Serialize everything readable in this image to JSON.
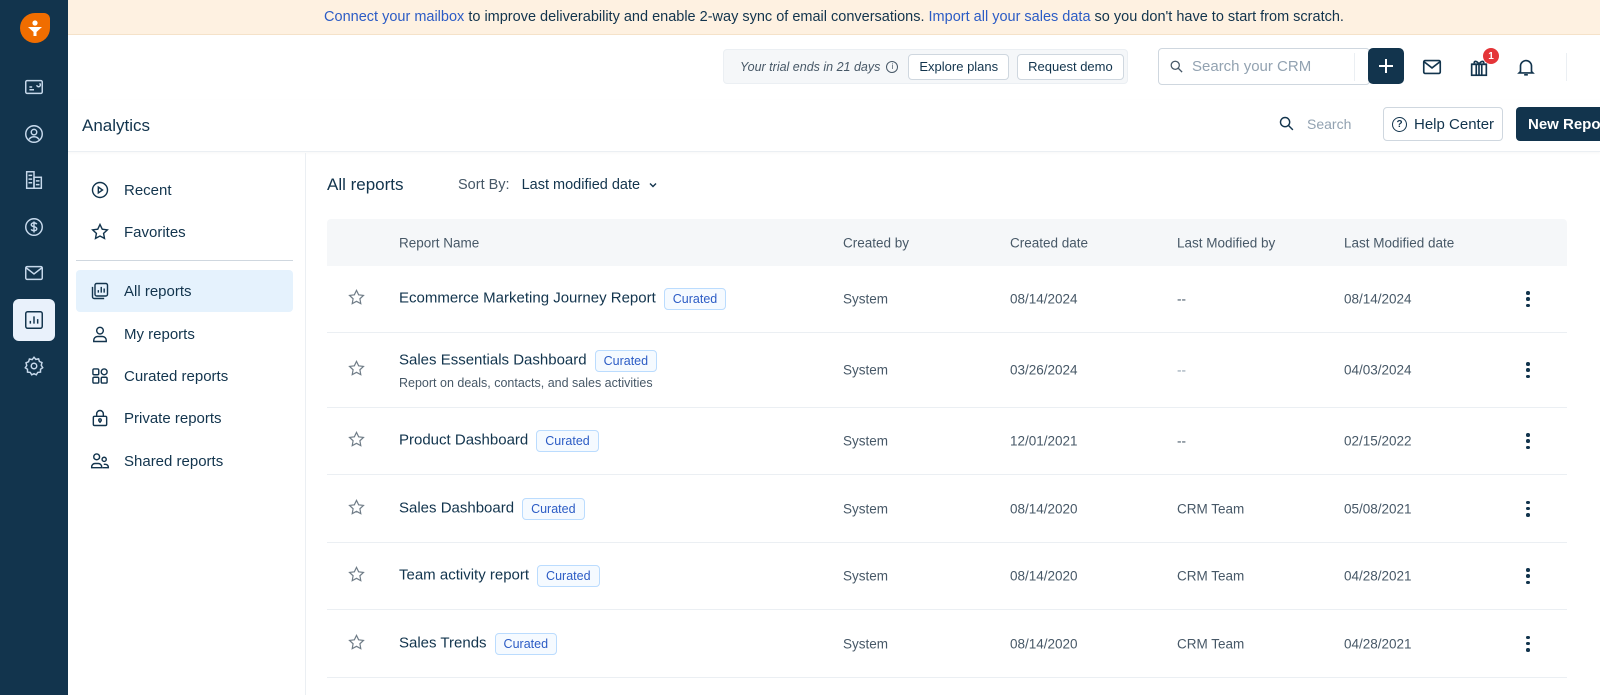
{
  "banner": {
    "link1": "Connect your mailbox",
    "text1": " to improve deliverability and enable 2-way sync of email conversations. ",
    "link2": "Import all your sales data",
    "text2": " so you don't have to start from scratch."
  },
  "rail": {
    "items": [
      {
        "name": "dashboard"
      },
      {
        "name": "contacts"
      },
      {
        "name": "accounts"
      },
      {
        "name": "deals"
      },
      {
        "name": "email"
      },
      {
        "name": "analytics",
        "active": true
      },
      {
        "name": "settings"
      }
    ]
  },
  "topbar": {
    "trial_text": "Your trial ends in 21 days",
    "explore_label": "Explore plans",
    "demo_label": "Request demo",
    "search_placeholder": "Search your CRM",
    "gift_badge": "1"
  },
  "header": {
    "title": "Analytics",
    "search_placeholder": "Search",
    "help_label": "Help Center",
    "new_label": "New Report"
  },
  "nav": {
    "items": [
      {
        "label": "Recent",
        "icon": "play-circle-icon"
      },
      {
        "label": "Favorites",
        "icon": "star-icon"
      },
      {
        "label": "All reports",
        "icon": "reports-icon",
        "active": true
      },
      {
        "label": "My reports",
        "icon": "user-icon"
      },
      {
        "label": "Curated reports",
        "icon": "grid-icon"
      },
      {
        "label": "Private reports",
        "icon": "lock-icon"
      },
      {
        "label": "Shared reports",
        "icon": "users-icon"
      }
    ]
  },
  "main": {
    "title": "All reports",
    "sort_label": "Sort By:",
    "sort_value": "Last modified date",
    "columns": [
      "Report Name",
      "Created by",
      "Created date",
      "Last Modified by",
      "Last Modified date"
    ],
    "rows": [
      {
        "name": "Ecommerce Marketing Journey Report",
        "badge": "Curated",
        "desc": "",
        "created_by": "System",
        "created_date": "08/14/2024",
        "modified_by": "--",
        "modified_date": "08/14/2024"
      },
      {
        "name": "Sales Essentials Dashboard",
        "badge": "Curated",
        "desc": "Report on deals, contacts, and sales activities",
        "created_by": "System",
        "created_date": "03/26/2024",
        "modified_by": "--",
        "modified_date": "04/03/2024"
      },
      {
        "name": "Product Dashboard",
        "badge": "Curated",
        "desc": "",
        "created_by": "System",
        "created_date": "12/01/2021",
        "modified_by": "--",
        "modified_date": "02/15/2022"
      },
      {
        "name": "Sales Dashboard",
        "badge": "Curated",
        "desc": "",
        "created_by": "System",
        "created_date": "08/14/2020",
        "modified_by": "CRM Team",
        "modified_date": "05/08/2021"
      },
      {
        "name": "Team activity report",
        "badge": "Curated",
        "desc": "",
        "created_by": "System",
        "created_date": "08/14/2020",
        "modified_by": "CRM Team",
        "modified_date": "04/28/2021"
      },
      {
        "name": "Sales Trends",
        "badge": "Curated",
        "desc": "",
        "created_by": "System",
        "created_date": "08/14/2020",
        "modified_by": "CRM Team",
        "modified_date": "04/28/2021"
      }
    ]
  }
}
